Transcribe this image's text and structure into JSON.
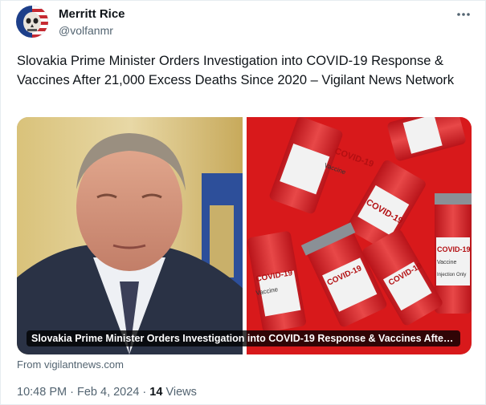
{
  "author": {
    "display_name": "Merritt Rice",
    "handle": "@volfanmr",
    "avatar_icon": "flag-skull-avatar"
  },
  "more_icon": "ellipsis-icon",
  "tweet": {
    "text": "Slovakia Prime Minister Orders Investigation into COVID-19 Response & Vaccines After 21,000 Excess Deaths Since 2020 – Vigilant News Network"
  },
  "link_card": {
    "caption": "Slovakia Prime Minister Orders Investigation into COVID-19 Response & Vaccines After ...",
    "source": "From vigilantnews.com",
    "vial_labels": {
      "brand": "COVID-19",
      "product": "Vaccine",
      "note": "Injection Only"
    }
  },
  "meta": {
    "time": "10:48 PM",
    "separator": "·",
    "date": "Feb 4, 2024",
    "views_count": "14",
    "views_label": "Views"
  },
  "colors": {
    "text_primary": "#0f1419",
    "text_secondary": "#536471",
    "vaccine_bg": "#d8191b",
    "vial_cap": "#8a9096"
  }
}
